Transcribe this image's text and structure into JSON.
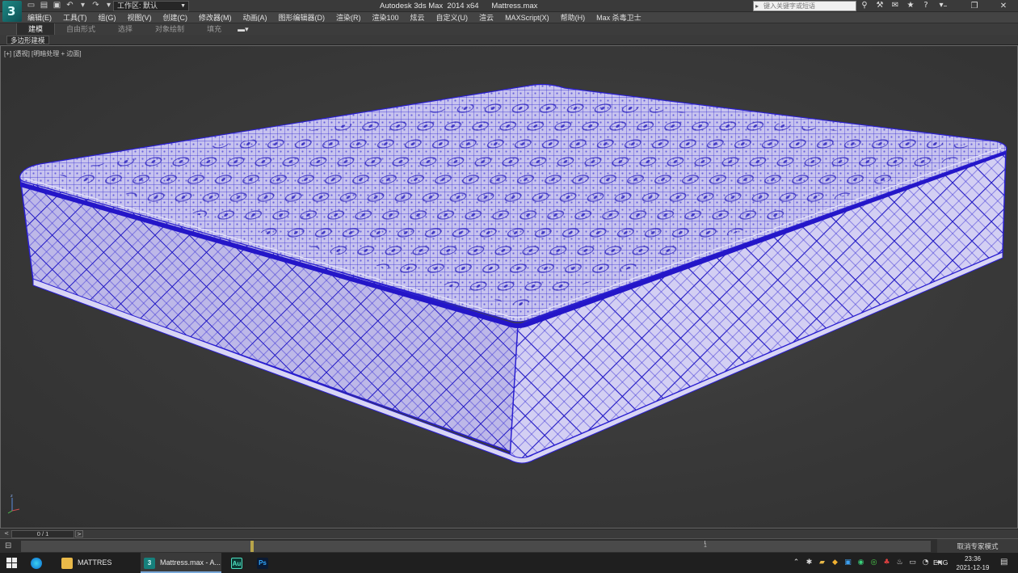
{
  "window": {
    "title_text": "Autodesk 3ds Max  2014 x64      Mattress.max",
    "app_logo_letter": "3"
  },
  "quick_access": {
    "workspace_label": "工作区: 默认",
    "search_placeholder": "键入关键字或短语"
  },
  "menu": {
    "items": [
      "编辑(E)",
      "工具(T)",
      "组(G)",
      "视图(V)",
      "创建(C)",
      "修改器(M)",
      "动画(A)",
      "图形编辑器(D)",
      "渲染(R)",
      "渲染100",
      "炫云",
      "自定义(U)",
      "渲云",
      "MAXScript(X)",
      "帮助(H)",
      "Max 杀毒卫士"
    ]
  },
  "ribbon": {
    "tabs": [
      "建模",
      "自由形式",
      "选择",
      "对象绘制",
      "填充"
    ],
    "active_tab": "建模",
    "panel_label": "多边形建模"
  },
  "viewport": {
    "label_plus": "[+]",
    "label_view": "[透视]",
    "label_shading": "[明暗处理 + 边面]"
  },
  "timeline": {
    "frame_display": "0 / 1",
    "tick_label": "1",
    "expert_mode": "取消专家模式"
  },
  "taskbar": {
    "tasks": [
      {
        "label": "MATTRES"
      },
      {
        "label": "Mattress.max - A..."
      },
      {
        "label": "Au"
      },
      {
        "label": "Ps"
      }
    ],
    "language": "ENG",
    "time": "23:36",
    "date": "2021-12-19"
  },
  "colors": {
    "wire": "#2a1fd0",
    "viewport_bg": "#3c3c3c"
  }
}
